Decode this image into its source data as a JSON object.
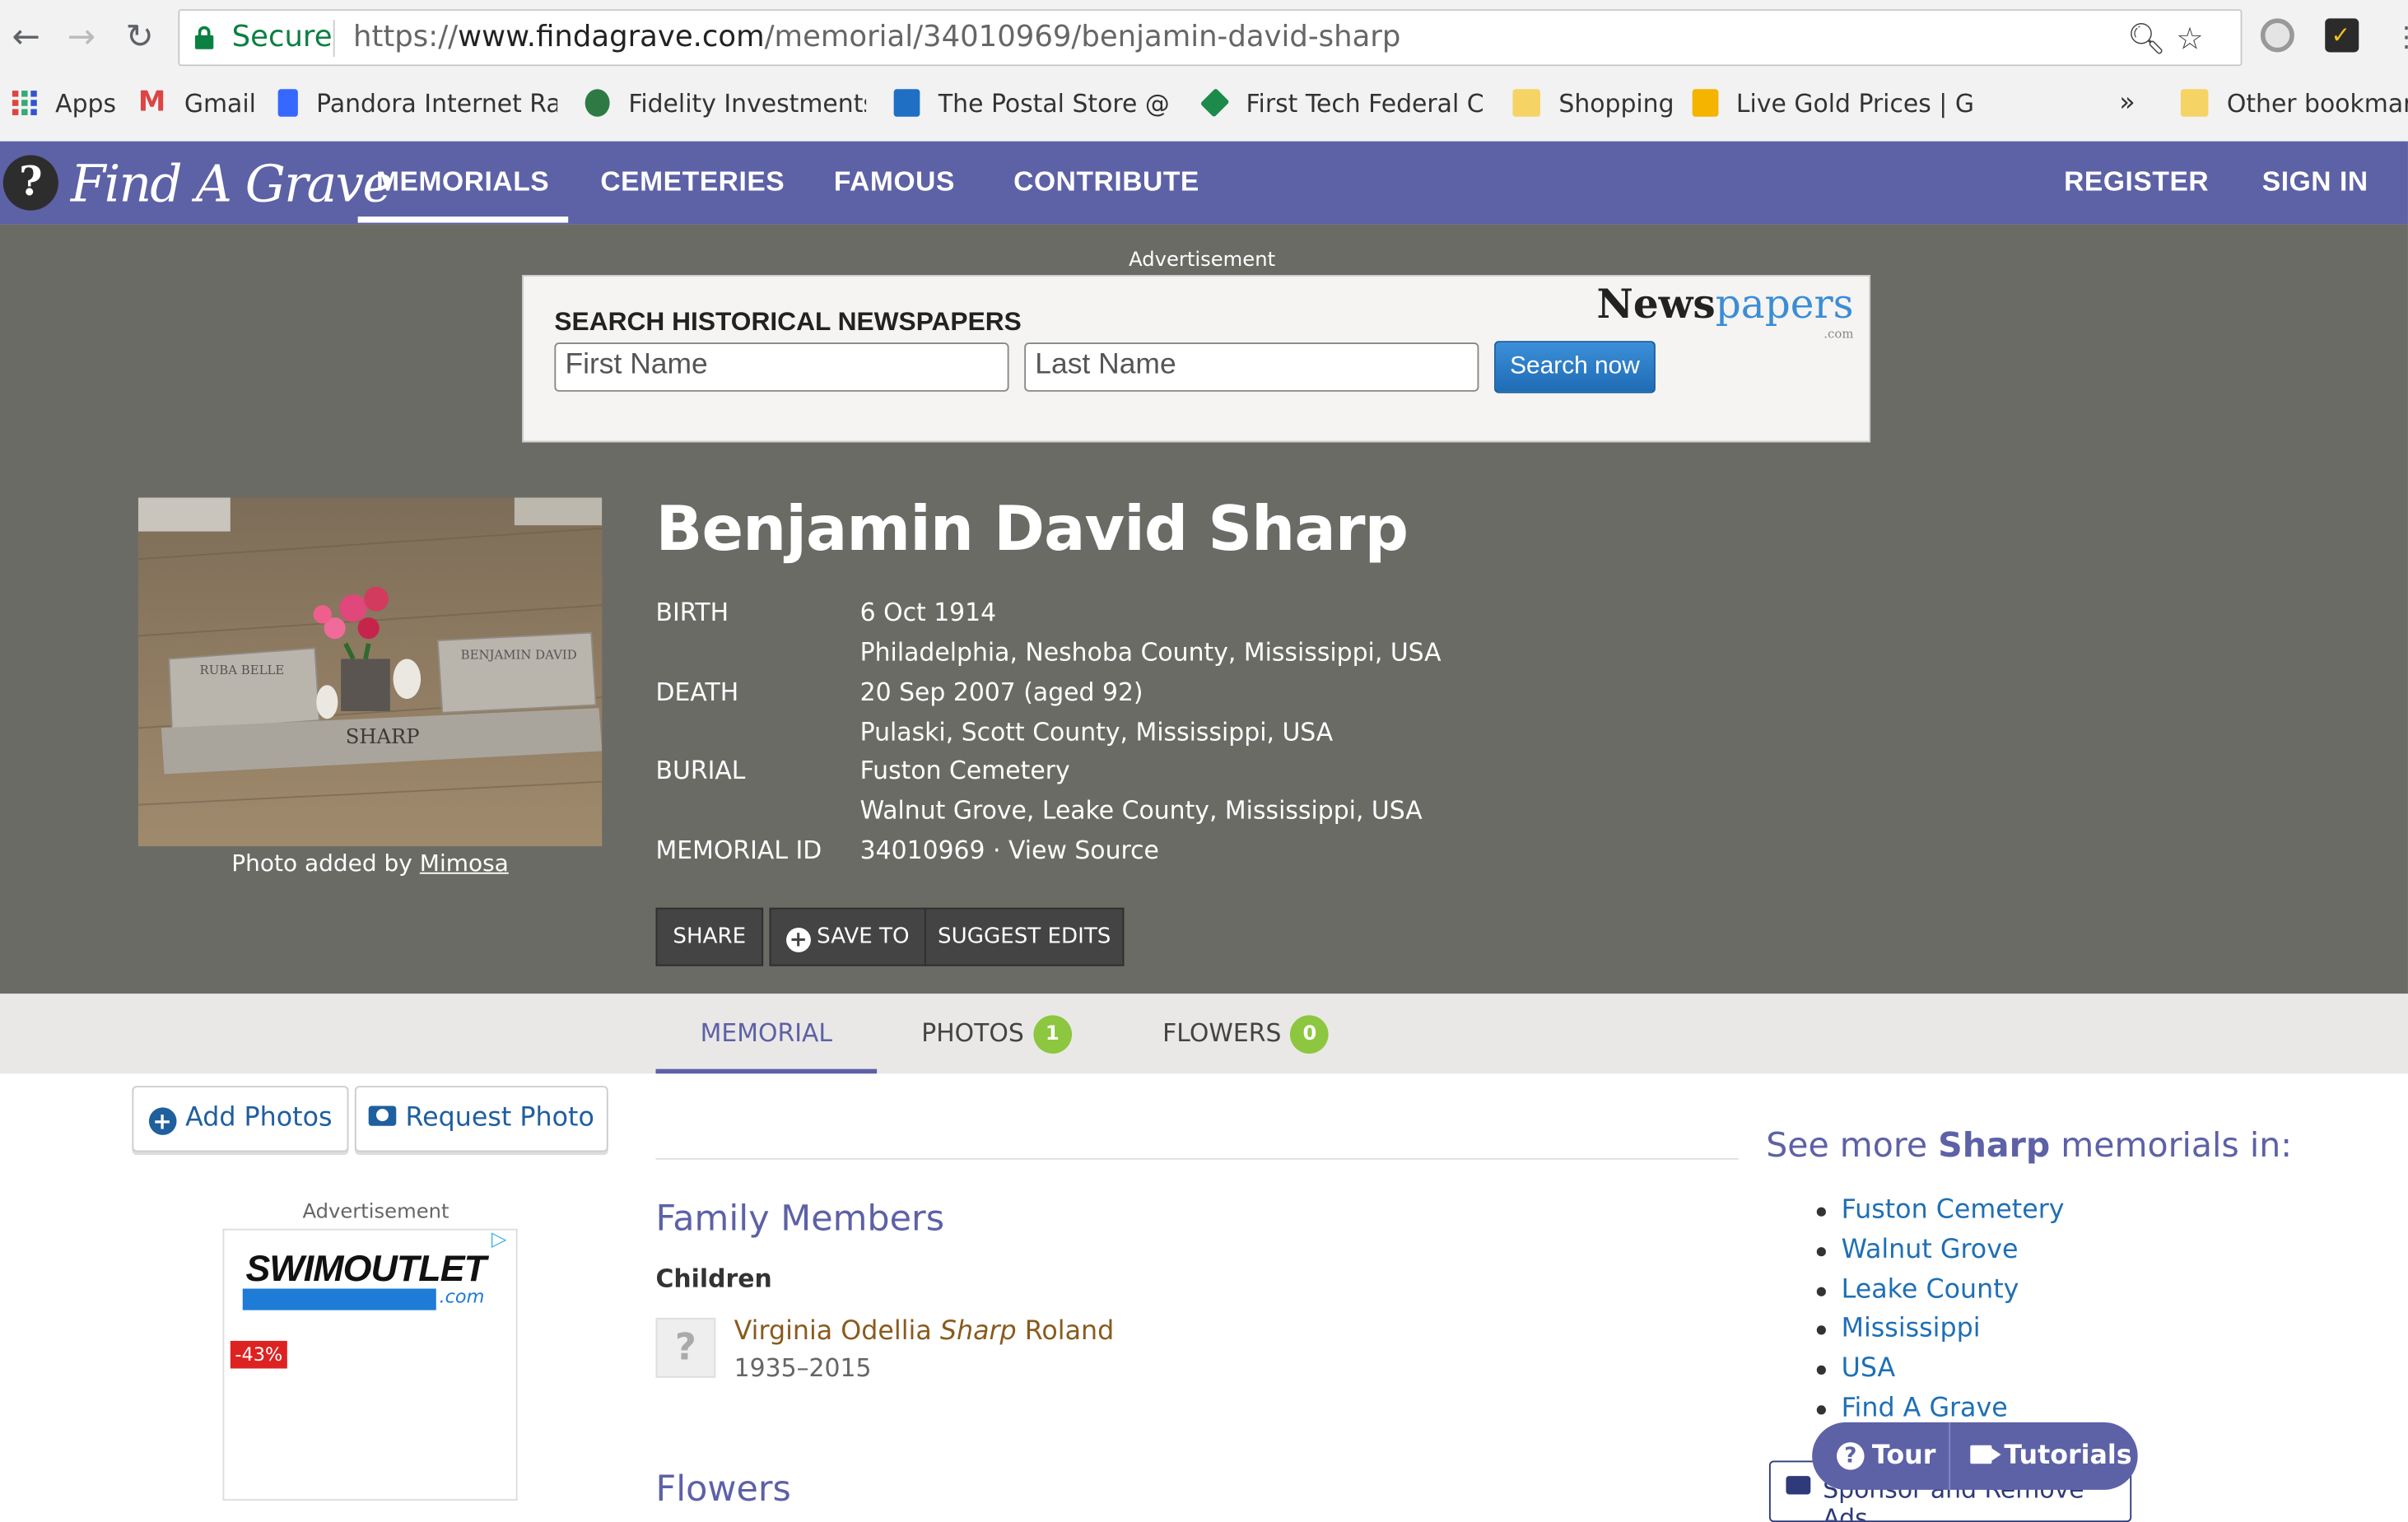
{
  "browser": {
    "secure_label": "Secure",
    "url_scheme": "https://",
    "url_domain": "www.findagrave.com",
    "url_path": "/memorial/34010969/benjamin-david-sharp"
  },
  "bookmarks": [
    {
      "label": "Apps"
    },
    {
      "label": "Gmail"
    },
    {
      "label": "Pandora Internet Rad"
    },
    {
      "label": "Fidelity Investments -"
    },
    {
      "label": "The Postal Store @ U"
    },
    {
      "label": "First Tech Federal Cre"
    },
    {
      "label": "Shopping"
    },
    {
      "label": "Live Gold Prices | Gol"
    },
    {
      "label": "»"
    },
    {
      "label": "Other bookmark"
    }
  ],
  "site": {
    "logo_text": "Find A Grave",
    "nav": [
      {
        "label": "MEMORIALS"
      },
      {
        "label": "CEMETERIES"
      },
      {
        "label": "FAMOUS"
      },
      {
        "label": "CONTRIBUTE"
      }
    ],
    "register": "REGISTER",
    "signin": "SIGN IN"
  },
  "ad_top": {
    "label": "Advertisement",
    "headline": "SEARCH HISTORICAL NEWSPAPERS",
    "brand_a": "News",
    "brand_b": "papers",
    "brand_com": ".com",
    "first_placeholder": "First Name",
    "last_placeholder": "Last Name",
    "button": "Search now"
  },
  "photo": {
    "caption_prefix": "Photo added by",
    "caption_user": "Mimosa",
    "stone_left": "RUBA BELLE",
    "stone_right": "BENJAMIN DAVID",
    "stone_surname": "SHARP"
  },
  "memorial": {
    "name": "Benjamin David Sharp",
    "birth_label": "BIRTH",
    "birth_date": "6 Oct 1914",
    "birth_place": "Philadelphia, Neshoba County, Mississippi, USA",
    "death_label": "DEATH",
    "death_date": "20 Sep 2007 (aged 92)",
    "death_place": "Pulaski, Scott County, Mississippi, USA",
    "burial_label": "BURIAL",
    "burial_cemetery": "Fuston Cemetery",
    "burial_place": "Walnut Grove, Leake County, Mississippi, USA",
    "id_label": "MEMORIAL ID",
    "id_value": "34010969",
    "id_sep": "·",
    "view_source": "View Source"
  },
  "actions": {
    "share": "SHARE",
    "save_to": "SAVE TO",
    "suggest_edits": "SUGGEST EDITS"
  },
  "tabs": [
    {
      "label": "MEMORIAL"
    },
    {
      "label": "PHOTOS",
      "count": "1"
    },
    {
      "label": "FLOWERS",
      "count": "0"
    }
  ],
  "left_col": {
    "add_photos": "Add Photos",
    "request_photo": "Request Photo",
    "ad_label": "Advertisement",
    "swim_brand": "SWIMOUTLET",
    "swim_com": ".com",
    "discount": "-43%"
  },
  "family": {
    "heading": "Family Members",
    "children_label": "Children",
    "child_first": "Virginia Odellia ",
    "child_maiden": "Sharp",
    "child_last": " Roland",
    "child_dates": "1935–2015"
  },
  "flowers_heading": "Flowers",
  "see_more": {
    "prefix": "See more ",
    "surname": "Sharp",
    "suffix": " memorials in:",
    "items": [
      "Fuston Cemetery",
      "Walnut Grove",
      "Leake County",
      "Mississippi",
      "USA",
      "Find A Grave"
    ]
  },
  "sponsor": "Sponsor and Remove Ads",
  "help": {
    "tour": "Tour",
    "tutorials": "Tutorials"
  },
  "colors": {
    "header": "#5d61a6",
    "hero": "#6b6b66",
    "accent_green": "#8dc63f",
    "link_blue": "#1f6fb5"
  }
}
